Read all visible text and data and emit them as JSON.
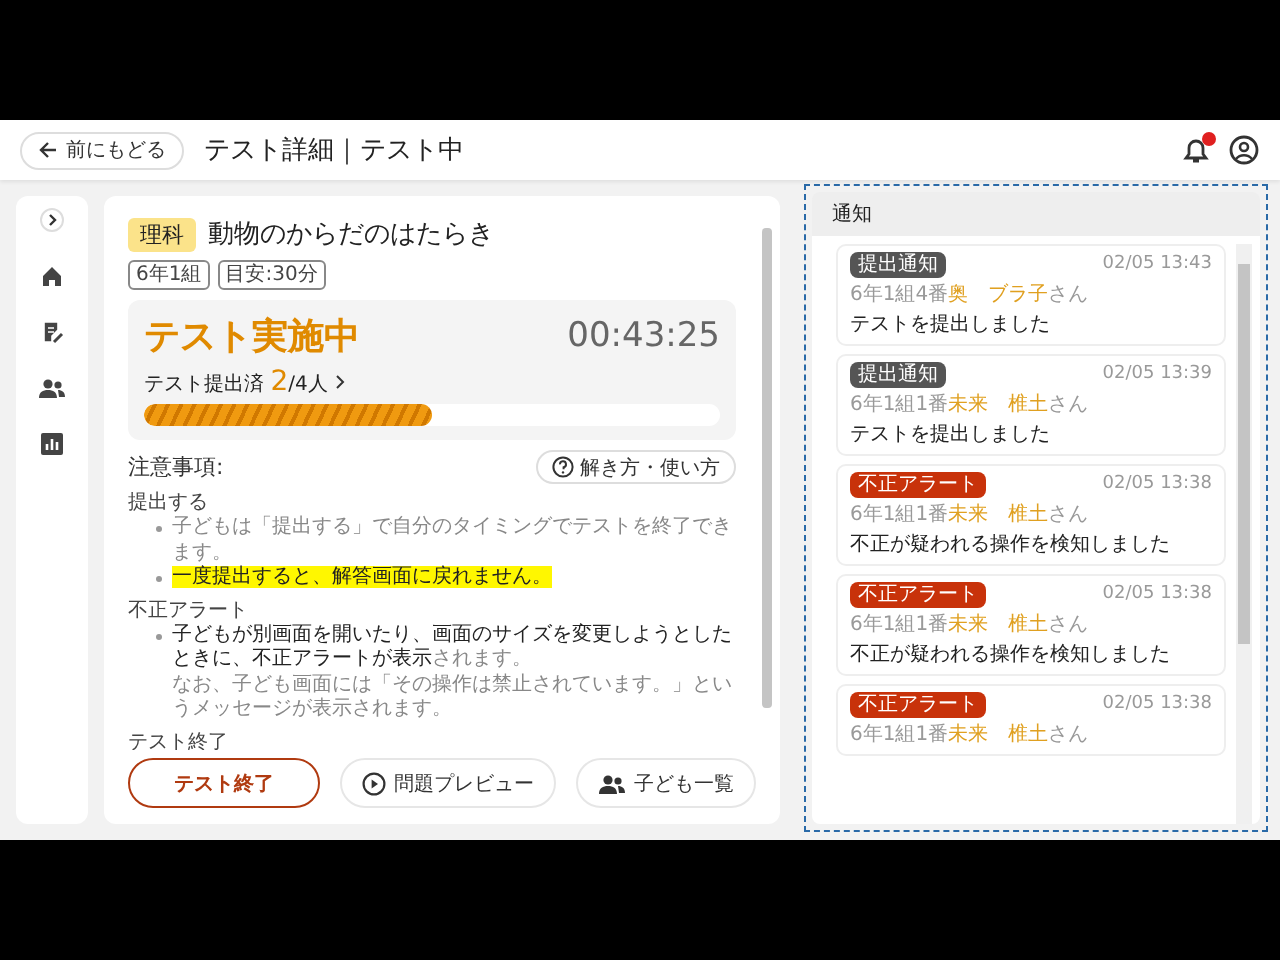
{
  "header": {
    "back_label": "前にもどる",
    "title": "テスト詳細｜テスト中",
    "notification_unread": true
  },
  "test": {
    "subject": "理科",
    "title": "動物のからだのはたらき",
    "tags": [
      "6年1組",
      "目安:30分"
    ],
    "status": "テスト実施中",
    "timer": "00:43:25",
    "progress_label": "テスト提出済 **2**/4人",
    "level": 0.5
  },
  "notes": {
    "heading": "注意事項:",
    "help_button": "解き方・使い方",
    "sections": [
      {
        "heading": "提出する",
        "items": [
          {
            "text": "子どもは「提出する」で自分のタイミングでテストを終了できます。",
            "highlighted": false
          },
          {
            "text": "一度提出すると、解答画面に戻れません。",
            "highlighted": true
          }
        ]
      },
      {
        "heading": "不正アラート",
        "items": [
          {
            "text": "**子どもが別画面を開いたり、画面のサイズを変更しようとしたときに、不正アラートが表示**されます。",
            "highlighted": false,
            "note": "なお、子ども画面には「その操作は禁止されています。」というメッセージが表示されます。"
          }
        ]
      },
      {
        "heading": "テスト終了"
      }
    ]
  },
  "actions": [
    {
      "label": "テスト終了",
      "kind": "end"
    },
    {
      "label": "問題プレビュー",
      "kind": "preview"
    },
    {
      "label": "子ども一覧",
      "kind": "students"
    }
  ],
  "notifications": {
    "title": "通知",
    "items": [
      {
        "kind": "submit",
        "badge": "提出通知",
        "time": "02/05 13:43",
        "student": "6年1組4番**奥　ブラ子**さん",
        "message": "テストを提出しました"
      },
      {
        "kind": "submit",
        "badge": "提出通知",
        "time": "02/05 13:39",
        "student": "6年1組1番**未来　椎土**さん",
        "message": "テストを提出しました"
      },
      {
        "kind": "alert",
        "badge": "不正アラート",
        "time": "02/05 13:38",
        "student": "6年1組1番**未来　椎土**さん",
        "message": "不正が疑われる操作を検知しました"
      },
      {
        "kind": "alert",
        "badge": "不正アラート",
        "time": "02/05 13:38",
        "student": "6年1組1番**未来　椎土**さん",
        "message": "不正が疑われる操作を検知しました"
      },
      {
        "kind": "alert",
        "badge": "不正アラート",
        "time": "02/05 13:38",
        "student": "6年1組1番**未来　椎土**さん"
      }
    ]
  }
}
